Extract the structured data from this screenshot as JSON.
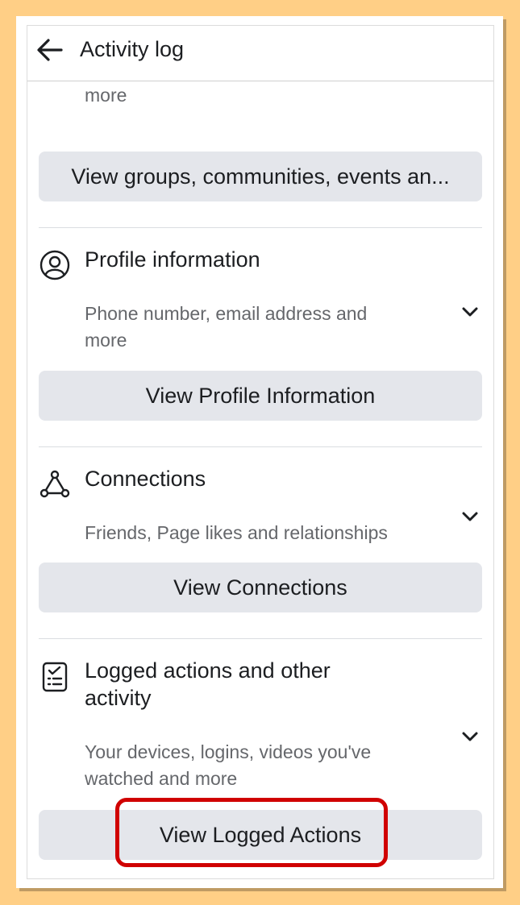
{
  "header": {
    "title": "Activity log"
  },
  "groups_section": {
    "subtitle_tail": "more",
    "button_label": "View groups, communities, events an..."
  },
  "profile_section": {
    "title": "Profile information",
    "subtitle_line1": "Phone number, email address and",
    "subtitle_line2": "more",
    "button_label": "View Profile Information"
  },
  "connections_section": {
    "title": "Connections",
    "subtitle": "Friends, Page likes and relationships",
    "button_label": "View Connections"
  },
  "logged_section": {
    "title_line1": "Logged actions and other",
    "title_line2": "activity",
    "subtitle_line1": "Your devices, logins, videos you've",
    "subtitle_line2": "watched and more",
    "button_label": "View Logged Actions"
  },
  "icons": {
    "back": "arrow-left-icon",
    "profile": "user-circle-icon",
    "connections": "network-triangle-icon",
    "logged": "checklist-icon",
    "expand": "chevron-down-icon"
  },
  "colors": {
    "background": "#FFCF86",
    "button_bg": "#e4e6eb",
    "text_primary": "#1c1e21",
    "text_secondary": "#65676b",
    "highlight": "#d00000"
  }
}
